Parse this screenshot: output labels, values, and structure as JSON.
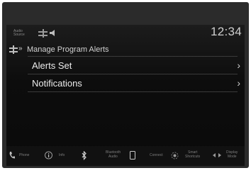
{
  "status": {
    "audio_source": [
      "Audio",
      "Source"
    ],
    "clock": "12:34"
  },
  "header": {
    "breadcrumb_glyph": "»",
    "title": "Manage Program Alerts"
  },
  "menu": {
    "items": [
      {
        "label": "Alerts Set",
        "chevron": "›"
      },
      {
        "label": "Notifications",
        "chevron": "›"
      }
    ]
  },
  "bottom_bar": {
    "phone": "Phone",
    "info": "Info",
    "bluetooth": [
      "Bluetooth",
      "Audio"
    ],
    "connect": "Connect",
    "smart": [
      "Smart",
      "Shortcuts"
    ],
    "display": [
      "Display",
      "Mode"
    ]
  },
  "colors": {
    "bezel": "#2b2b2b",
    "screen": "#0d0d0d",
    "text": "#ececec"
  }
}
